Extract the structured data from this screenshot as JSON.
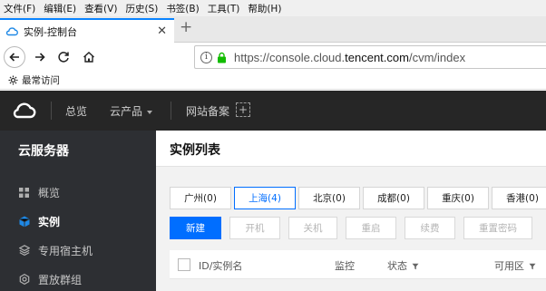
{
  "browser": {
    "menu": [
      "文件(F)",
      "编辑(E)",
      "查看(V)",
      "历史(S)",
      "书签(B)",
      "工具(T)",
      "帮助(H)"
    ],
    "tab_title": "实例-控制台",
    "url_prefix": "https://console.cloud.",
    "url_domain": "tencent.com",
    "url_path": "/cvm/index",
    "bookmark_label": "最常访问"
  },
  "topbar": {
    "nav_overview": "总览",
    "nav_products": "云产品",
    "nav_record": "网站备案",
    "plus": "+"
  },
  "sidebar": {
    "title": "云服务器",
    "items": [
      {
        "label": "概览",
        "icon": "grid-icon"
      },
      {
        "label": "实例",
        "icon": "cube-icon"
      },
      {
        "label": "专用宿主机",
        "icon": "layers-icon"
      },
      {
        "label": "置放群组",
        "icon": "gear-icon"
      }
    ]
  },
  "main": {
    "title": "实例列表",
    "regions": [
      "广州(0)",
      "上海(4)",
      "北京(0)",
      "成都(0)",
      "重庆(0)",
      "香港(0)"
    ],
    "actions": {
      "create": "新建",
      "start": "开机",
      "stop": "关机",
      "restart": "重启",
      "renew": "续费",
      "reset_password": "重置密码"
    },
    "columns": {
      "id_name": "ID/实例名",
      "monitor": "监控",
      "status": "状态",
      "zone": "可用区"
    }
  },
  "colors": {
    "accent": "#006eff",
    "topbar_bg": "#262626",
    "sidebar_bg": "#2d2f33",
    "firefox_tab_accent": "#0a84ff",
    "lock_green": "#12bc00"
  }
}
